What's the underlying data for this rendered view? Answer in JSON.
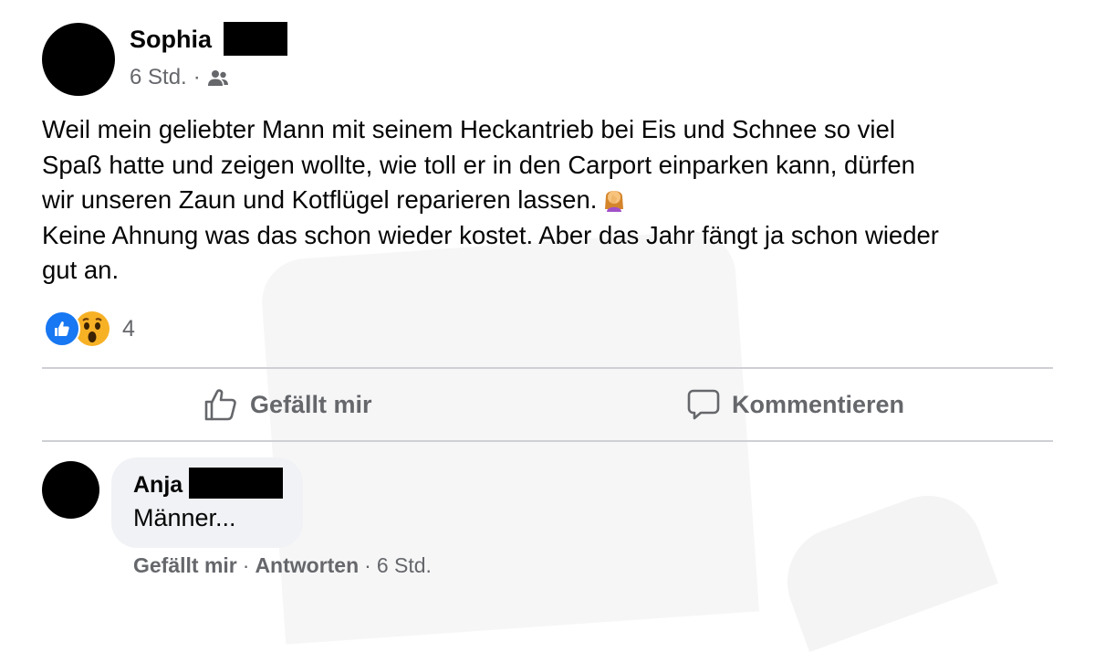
{
  "post": {
    "author_name": "Sophia",
    "timestamp": "6 Std.",
    "separator": "·",
    "audience_icon": "friends-icon",
    "text_lines": [
      "Weil mein geliebter Mann mit seinem Heckantrieb bei Eis und Schnee so viel",
      "Spaß hatte und zeigen wollte, wie toll er in den Carport einparken kann, dürfen",
      "wir unseren Zaun und Kotflügel reparieren lassen.",
      "Keine Ahnung was das schon wieder kostet. Aber das Jahr fängt ja schon wieder",
      "gut an."
    ],
    "inline_emoji": "facepalm-emoji",
    "reactions": {
      "types": [
        "like",
        "wow"
      ],
      "count": "4"
    }
  },
  "actions": {
    "like_label": "Gefällt mir",
    "comment_label": "Kommentieren"
  },
  "comment": {
    "author_name": "Anja",
    "text": "Männer...",
    "like_label": "Gefällt mir",
    "reply_label": "Antworten",
    "separator": "·",
    "timestamp": "6 Std."
  },
  "colors": {
    "primary_text": "#050505",
    "secondary_text": "#65676b",
    "like_blue": "#1877f2",
    "wow_yellow": "#f7b125",
    "divider": "#ced0d4",
    "bubble_bg": "#f0f2f5"
  }
}
